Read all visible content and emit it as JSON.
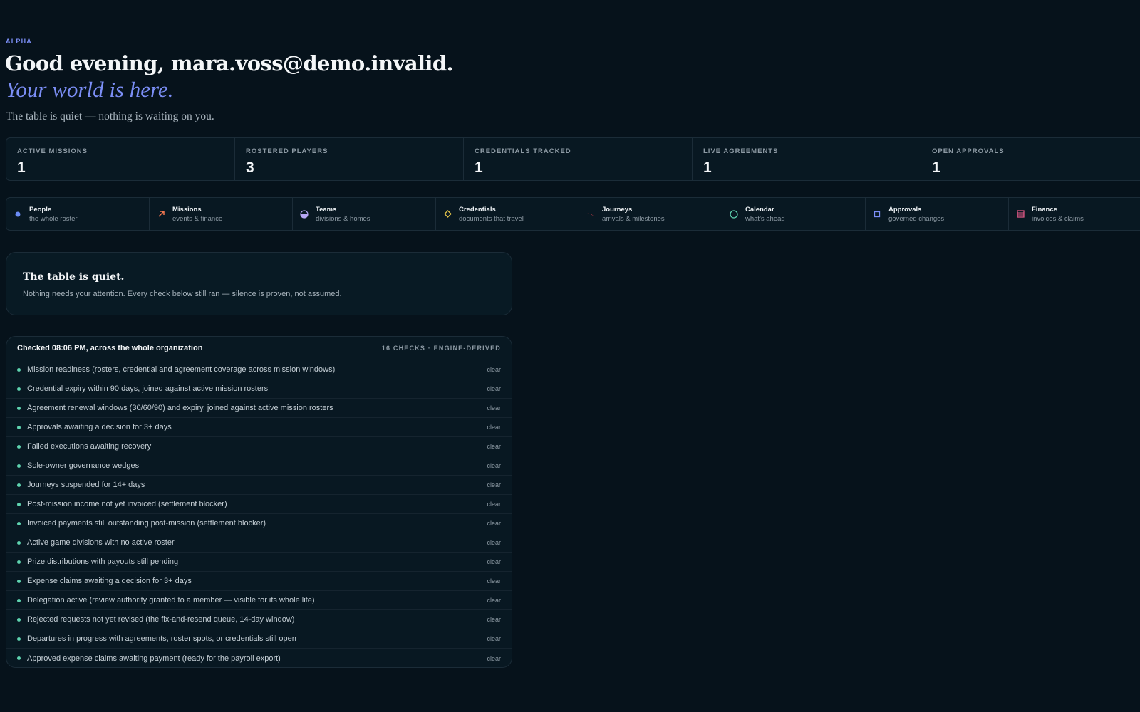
{
  "header": {
    "eyebrow": "ALPHA",
    "greeting": "Good evening, mara.voss@demo.invalid.",
    "tagline": "Your world is here.",
    "subline": "The table is quiet — nothing is waiting on you."
  },
  "stats": [
    {
      "label": "ACTIVE MISSIONS",
      "value": "1"
    },
    {
      "label": "ROSTERED PLAYERS",
      "value": "3"
    },
    {
      "label": "CREDENTIALS TRACKED",
      "value": "1"
    },
    {
      "label": "LIVE AGREEMENTS",
      "value": "1"
    },
    {
      "label": "OPEN APPROVALS",
      "value": "1"
    }
  ],
  "modules": [
    {
      "title": "People",
      "sub": "the whole roster",
      "icon": "dot-icon",
      "color": "#6b8cf5"
    },
    {
      "title": "Missions",
      "sub": "events & finance",
      "icon": "arrow-icon",
      "color": "#f0764f"
    },
    {
      "title": "Teams",
      "sub": "divisions & homes",
      "icon": "half-circle-icon",
      "color": "#b6a6f5"
    },
    {
      "title": "Credentials",
      "sub": "documents that travel",
      "icon": "diamond-icon",
      "color": "#e8c84a"
    },
    {
      "title": "Journeys",
      "sub": "arrivals & milestones",
      "icon": "flight-icon",
      "color": "#e8444f"
    },
    {
      "title": "Calendar",
      "sub": "what's ahead",
      "icon": "circle-icon",
      "color": "#5fd4b0"
    },
    {
      "title": "Approvals",
      "sub": "governed changes",
      "icon": "square-icon",
      "color": "#7b8ef5"
    },
    {
      "title": "Finance",
      "sub": "invoices & claims",
      "icon": "ledger-icon",
      "color": "#e85a8a"
    }
  ],
  "quiet": {
    "title": "The table is quiet.",
    "body": "Nothing needs your attention. Every check below still ran — silence is proven, not assumed."
  },
  "checks": {
    "title": "Checked 08:06 PM, across the whole organization",
    "meta": "16 CHECKS · ENGINE-DERIVED",
    "items": [
      {
        "label": "Mission readiness (rosters, credential and agreement coverage across mission windows)",
        "status": "clear"
      },
      {
        "label": "Credential expiry within 90 days, joined against active mission rosters",
        "status": "clear"
      },
      {
        "label": "Agreement renewal windows (30/60/90) and expiry, joined against active mission rosters",
        "status": "clear"
      },
      {
        "label": "Approvals awaiting a decision for 3+ days",
        "status": "clear"
      },
      {
        "label": "Failed executions awaiting recovery",
        "status": "clear"
      },
      {
        "label": "Sole-owner governance wedges",
        "status": "clear"
      },
      {
        "label": "Journeys suspended for 14+ days",
        "status": "clear"
      },
      {
        "label": "Post-mission income not yet invoiced (settlement blocker)",
        "status": "clear"
      },
      {
        "label": "Invoiced payments still outstanding post-mission (settlement blocker)",
        "status": "clear"
      },
      {
        "label": "Active game divisions with no active roster",
        "status": "clear"
      },
      {
        "label": "Prize distributions with payouts still pending",
        "status": "clear"
      },
      {
        "label": "Expense claims awaiting a decision for 3+ days",
        "status": "clear"
      },
      {
        "label": "Delegation active (review authority granted to a member — visible for its whole life)",
        "status": "clear"
      },
      {
        "label": "Rejected requests not yet revised (the fix-and-resend queue, 14-day window)",
        "status": "clear"
      },
      {
        "label": "Departures in progress with agreements, roster spots, or credentials still open",
        "status": "clear"
      },
      {
        "label": "Approved expense claims awaiting payment (ready for the payroll export)",
        "status": "clear"
      }
    ]
  }
}
